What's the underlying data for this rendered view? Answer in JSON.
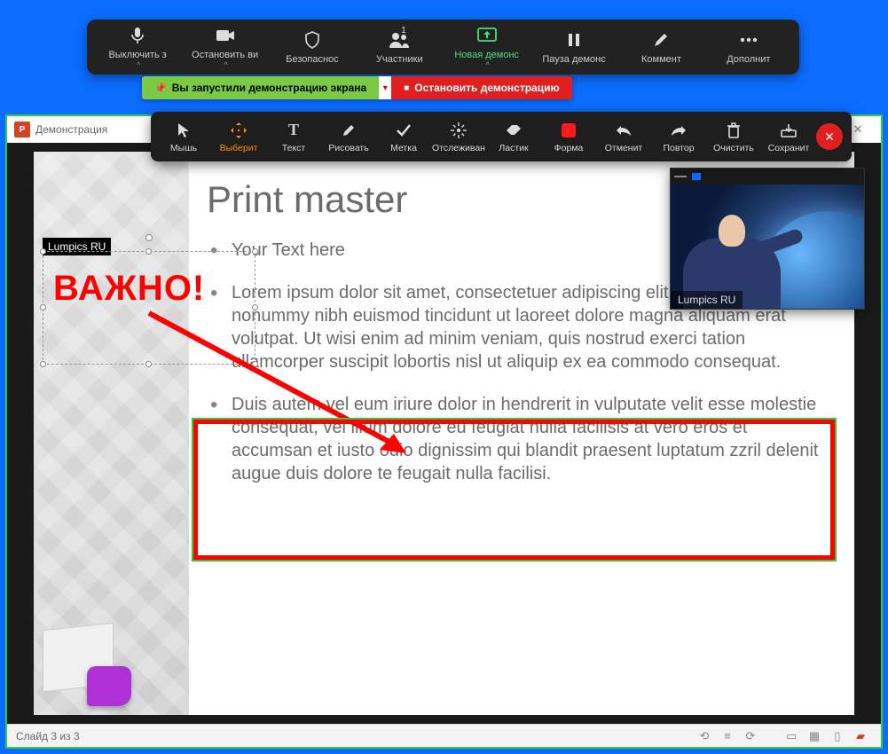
{
  "zoom_bar": {
    "mute": {
      "label": "Выключить з"
    },
    "video": {
      "label": "Остановить ви"
    },
    "security": {
      "label": "Безопаснос"
    },
    "participants": {
      "label": "Участники",
      "count": "1"
    },
    "new_share": {
      "label": "Новая демонс"
    },
    "pause_share": {
      "label": "Пауза демонс"
    },
    "comment": {
      "label": "Коммент"
    },
    "more": {
      "label": "Дополнит"
    }
  },
  "status": {
    "started": "Вы запустили демонстрацию экрана",
    "stop": "Остановить демонстрацию"
  },
  "anno": {
    "mouse": "Мышь",
    "select": "Выберит",
    "text": "Текст",
    "draw": "Рисовать",
    "stamp": "Метка",
    "spot": "Отслеживан",
    "eraser": "Ластик",
    "shape": "Форма",
    "undo": "Отменит",
    "redo": "Повтор",
    "clear": "Очистить",
    "save": "Сохранит"
  },
  "ppt": {
    "title_prefix": "Демонстрация",
    "status": "Слайд 3 из 3"
  },
  "slide": {
    "title": "Print master",
    "bullet1": "Your Text here",
    "bullet2": "Lorem ipsum dolor sit amet, consectetuer adipiscing elit, sed diam nonummy nibh euismod tincidunt ut laoreet dolore magna aliquam erat volutpat. Ut wisi enim ad minim veniam, quis nostrud exerci tation ullamcorper suscipit lobortis nisl ut aliquip ex ea commodo consequat.",
    "bullet3": "Duis autem vel eum iriure dolor in hendrerit in vulputate velit esse molestie consequat, vel illum dolore eu feugiat nulla facilisis at vero eros et accumsan et iusto odio dignissim qui blandit praesent luptatum zzril delenit augue duis dolore te feugait nulla facilisi."
  },
  "annotation": {
    "label": "Lumpics RU",
    "important": "ВАЖНО!"
  },
  "self_view": {
    "name": "Lumpics RU"
  }
}
